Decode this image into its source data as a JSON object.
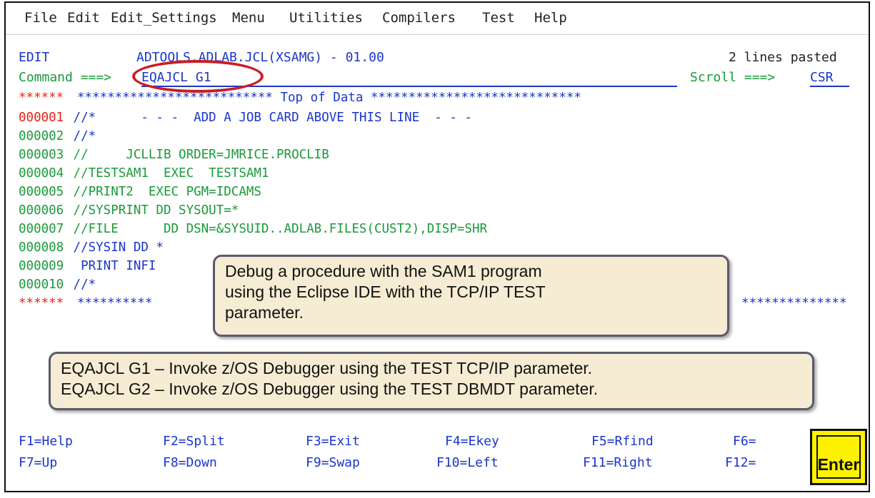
{
  "menu": {
    "file": "File",
    "edit": "Edit",
    "edit_settings": "Edit_Settings",
    "menu": "Menu",
    "utilities": "Utilities",
    "compilers": "Compilers",
    "test": "Test",
    "help": "Help"
  },
  "header": {
    "mode": "EDIT",
    "dataset": "ADTOOLS.ADLAB.JCL(XSAMG) - 01.00",
    "message": "2 lines pasted",
    "command_label": "Command ===>",
    "command_value": "EQAJCL G1",
    "scroll_label": "Scroll ===>",
    "scroll_value": "CSR"
  },
  "top_of_data": {
    "prefix": "******",
    "text": "************************** Top of Data ****************************"
  },
  "lines": [
    {
      "num": "000001",
      "text": " //*      - - -  ADD A JOB CARD ABOVE THIS LINE  - - -"
    },
    {
      "num": "000002",
      "text": " //*"
    },
    {
      "num": "000003",
      "text": " //     JCLLIB ORDER=JMRICE.PROCLIB"
    },
    {
      "num": "000004",
      "text": " //TESTSAM1  EXEC  TESTSAM1"
    },
    {
      "num": "000005",
      "text": " //PRINT2  EXEC PGM=IDCAMS"
    },
    {
      "num": "000006",
      "text": " //SYSPRINT DD SYSOUT=*"
    },
    {
      "num": "000007",
      "text": " //FILE      DD DSN=&SYSUID..ADLAB.FILES(CUST2),DISP=SHR"
    },
    {
      "num": "000008",
      "text": " //SYSIN DD *"
    },
    {
      "num": "000009",
      "text": "  PRINT INFI"
    },
    {
      "num": "000010",
      "text": " //*"
    }
  ],
  "bottom_of_data": {
    "prefix": "******",
    "left": "**********",
    "right": "**************"
  },
  "callout_top": {
    "line1": "Debug a procedure with the SAM1 program",
    "line2": "using the Eclipse IDE with the TCP/IP TEST",
    "line3": "parameter."
  },
  "callout_bottom": {
    "line1": "EQAJCL G1 – Invoke z/OS Debugger using the TEST TCP/IP parameter.",
    "line2": "EQAJCL G2 – Invoke z/OS Debugger using the TEST DBMDT parameter."
  },
  "fkeys_row1": [
    "F1=Help",
    "F2=Split",
    "F3=Exit",
    "F4=Ekey",
    "F5=Rfind",
    "F6="
  ],
  "fkeys_row2": [
    "F7=Up",
    "F8=Down",
    "F9=Swap",
    "F10=Left",
    "F11=Right",
    "F12="
  ],
  "enter_button": "Enter",
  "colors": {
    "ispf_blue": "#1b36c9",
    "ispf_green": "#1a9a3a",
    "ispf_red": "#e3261a",
    "callout_bg": "#f6ecd3",
    "enter_yellow": "#fff200",
    "annotation_red": "#c81d25"
  }
}
